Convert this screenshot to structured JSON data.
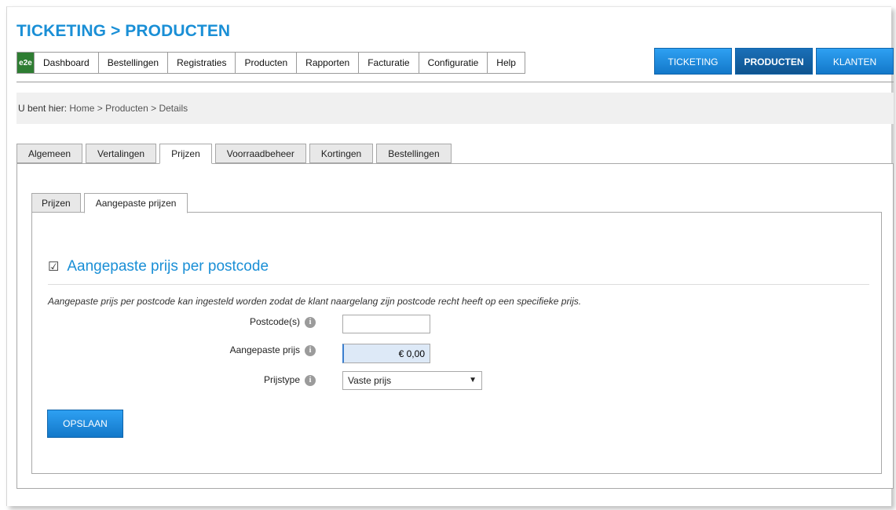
{
  "page_title": "TICKETING > PRODUCTEN",
  "logo_text": "e2e",
  "menu": [
    "Dashboard",
    "Bestellingen",
    "Registraties",
    "Producten",
    "Rapporten",
    "Facturatie",
    "Configuratie",
    "Help"
  ],
  "top_buttons": [
    {
      "label": "TICKETING",
      "active": false
    },
    {
      "label": "PRODUCTEN",
      "active": true
    },
    {
      "label": "KLANTEN",
      "active": false
    }
  ],
  "breadcrumb": {
    "label": "U bent hier:",
    "path": "Home > Producten > Details"
  },
  "main_tabs": [
    "Algemeen",
    "Vertalingen",
    "Prijzen",
    "Voorraadbeheer",
    "Kortingen",
    "Bestellingen"
  ],
  "main_tab_active": "Prijzen",
  "sub_tabs": [
    "Prijzen",
    "Aangepaste prijzen"
  ],
  "sub_tab_active": "Aangepaste prijzen",
  "section": {
    "checkbox_glyph": "☑",
    "title": "Aangepaste prijs per postcode",
    "description": "Aangepaste prijs per postcode kan ingesteld worden zodat de klant naargelang zijn postcode recht heeft op een specifieke prijs."
  },
  "form": {
    "postcode_label": "Postcode(s)",
    "postcode_value": "",
    "price_label": "Aangepaste prijs",
    "price_value": "€ 0,00",
    "pricetype_label": "Prijstype",
    "pricetype_value": "Vaste prijs",
    "info_glyph": "i"
  },
  "save_button": "OPSLAAN",
  "colors": {
    "accent": "#1a8fd6",
    "button": "#1378c9",
    "button_active": "#0f548f"
  }
}
